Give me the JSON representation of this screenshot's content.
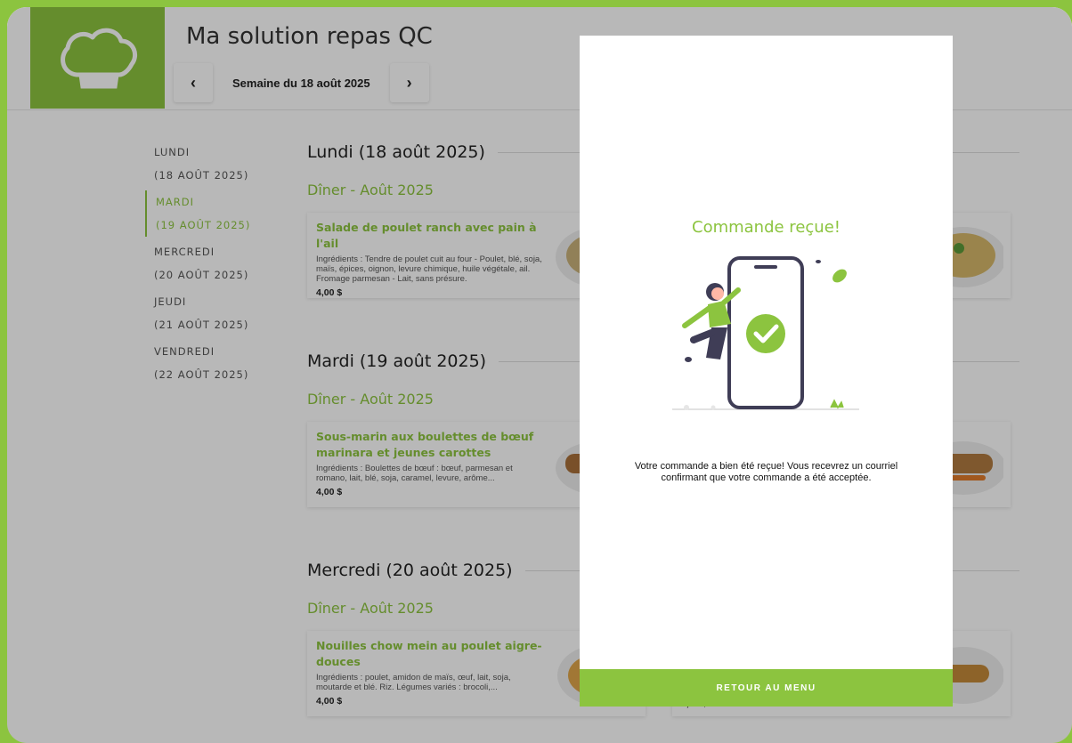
{
  "header": {
    "app_title": "Ma solution repas QC",
    "week_label": "Semaine du 18 août 2025",
    "prev_icon": "chevron-left-icon",
    "next_icon": "chevron-right-icon",
    "logo_icon": "chef-hat-icon"
  },
  "sidebar": {
    "items": [
      {
        "day": "LUNDI",
        "date": "(18 AOÛT 2025)",
        "active": false
      },
      {
        "day": "MARDI",
        "date": "(19 AOÛT 2025)",
        "active": true
      },
      {
        "day": "MERCREDI",
        "date": "(20 AOÛT 2025)",
        "active": false
      },
      {
        "day": "JEUDI",
        "date": "(21 AOÛT 2025)",
        "active": false
      },
      {
        "day": "VENDREDI",
        "date": "(22 AOÛT 2025)",
        "active": false
      }
    ]
  },
  "main": {
    "days": [
      {
        "title": "Lundi (18 août 2025)",
        "meal": "Dîner - Août 2025",
        "cards": [
          {
            "name": "Salade de poulet ranch avec pain à l'ail",
            "ingredients": "Ingrédients : Tendre de poulet cuit au four - Poulet, blé, soja, maïs, épices, oignon, levure chimique, huile végétale, ail. Fromage parmesan - Lait, sans présure.",
            "price": "4,00 $"
          },
          {
            "name": "",
            "ingredients": "",
            "price": ""
          }
        ]
      },
      {
        "title": "Mardi (19 août 2025)",
        "meal": "Dîner - Août 2025",
        "cards": [
          {
            "name": "Sous-marin aux boulettes de bœuf marinara et jeunes carottes",
            "ingredients": "Ingrédients : Boulettes de bœuf : bœuf, parmesan et romano, lait, blé, soja, caramel, levure, arôme...",
            "price": "4,00 $"
          },
          {
            "name": "",
            "ingredients": "",
            "price": ""
          }
        ]
      },
      {
        "title": "Mercredi (20 août 2025)",
        "meal": "Dîner - Août 2025",
        "cards": [
          {
            "name": "Nouilles chow mein au poulet aigre-douces",
            "ingredients": "Ingrédients : poulet, amidon de maïs, œuf, lait, soja, moutarde et blé. Riz. Légumes variés : brocoli,...",
            "price": "4,00 $"
          },
          {
            "name": "",
            "ingredients": "",
            "price": "4,00 $"
          }
        ]
      }
    ]
  },
  "modal": {
    "title": "Commande reçue!",
    "message": "Votre commande a bien été reçue! Vous recevrez un courriel confirmant que votre commande a été acceptée.",
    "button_label": "RETOUR AU MENU",
    "illustration_icon": "order-confirmed-illustration"
  },
  "colors": {
    "accent": "#8cc43f",
    "overlay": "rgba(0,0,0,0.28)",
    "phone": "#3f3d56"
  }
}
